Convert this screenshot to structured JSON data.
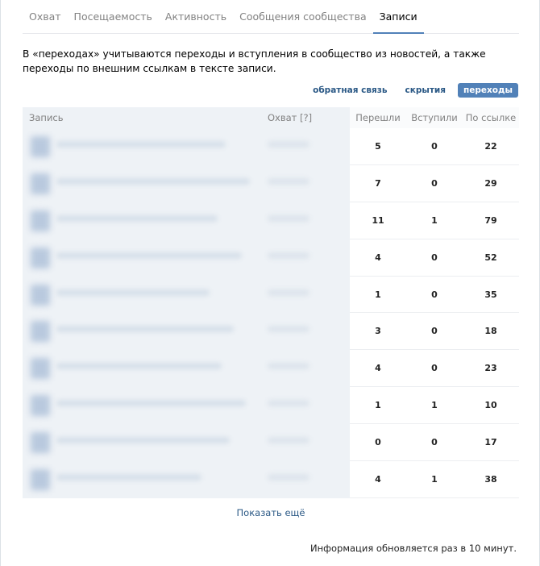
{
  "tabs": [
    {
      "label": "Охват"
    },
    {
      "label": "Посещаемость"
    },
    {
      "label": "Активность"
    },
    {
      "label": "Сообщения сообщества"
    },
    {
      "label": "Записи",
      "active": true
    }
  ],
  "description": "В «переходах» учитываются переходы и вступления в сообщество из новостей, а также переходы по внешним ссылкам в тексте записи.",
  "filters": [
    {
      "label": "обратная связь"
    },
    {
      "label": "скрытия"
    },
    {
      "label": "переходы",
      "active": true
    }
  ],
  "table": {
    "headers": {
      "post": "Запись",
      "reach": "Охват [?]",
      "went": "Перешли",
      "joined": "Вступили",
      "by_link": "По ссылке"
    },
    "rows": [
      {
        "went": "5",
        "joined": "0",
        "by_link": "22"
      },
      {
        "went": "7",
        "joined": "0",
        "by_link": "29"
      },
      {
        "went": "11",
        "joined": "1",
        "by_link": "79"
      },
      {
        "went": "4",
        "joined": "0",
        "by_link": "52"
      },
      {
        "went": "1",
        "joined": "0",
        "by_link": "35"
      },
      {
        "went": "3",
        "joined": "0",
        "by_link": "18"
      },
      {
        "went": "4",
        "joined": "0",
        "by_link": "23"
      },
      {
        "went": "1",
        "joined": "1",
        "by_link": "10"
      },
      {
        "went": "0",
        "joined": "0",
        "by_link": "17"
      },
      {
        "went": "4",
        "joined": "1",
        "by_link": "38"
      }
    ]
  },
  "show_more": "Показать ещё",
  "footer_note": "Информация обновляется раз в 10 минут.",
  "colors": {
    "accent": "#5181b8",
    "link": "#2a5885",
    "blurred_bg": "#eef2f6"
  }
}
